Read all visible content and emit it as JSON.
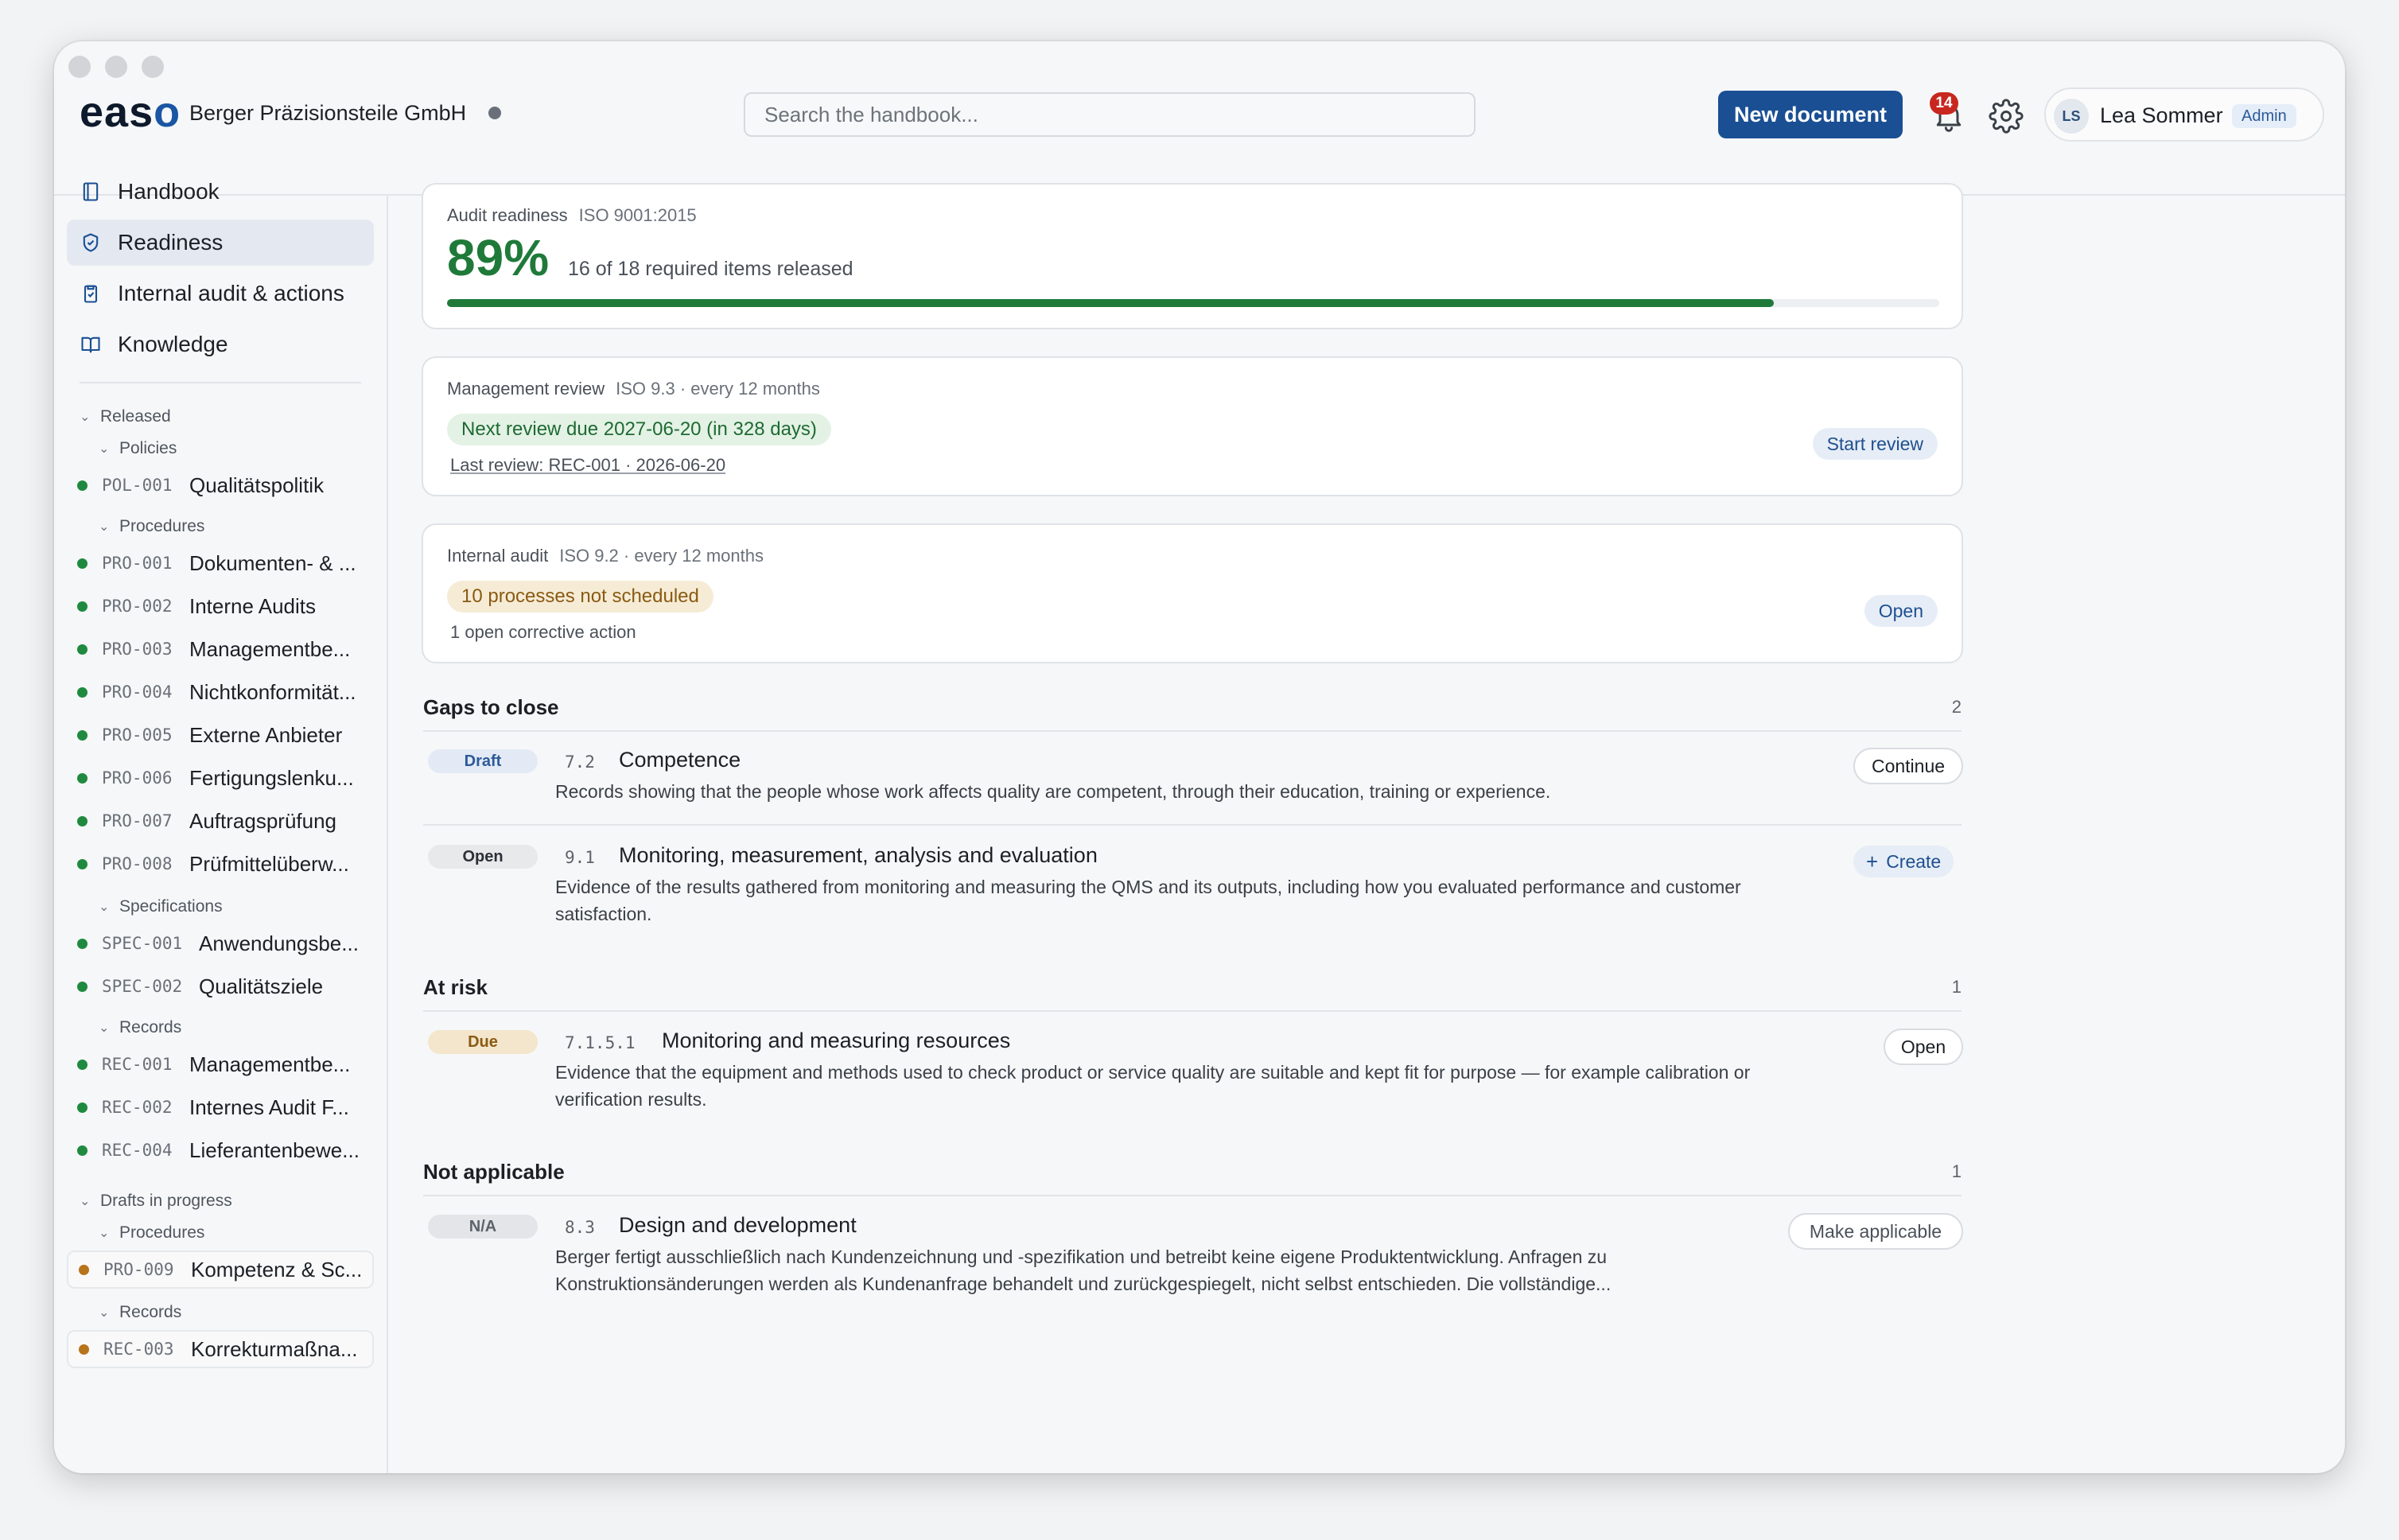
{
  "app": {
    "logo": "easo",
    "org_name": "Berger Präzisionsteile GmbH",
    "search_placeholder": "Search the handbook...",
    "new_document_label": "New document",
    "notification_count": "14",
    "user": {
      "initials": "LS",
      "name": "Lea Sommer",
      "role": "Admin"
    }
  },
  "sidebar": {
    "nav": [
      {
        "label": "Handbook",
        "icon": "book-icon"
      },
      {
        "label": "Readiness",
        "icon": "shield-check-icon",
        "active": true
      },
      {
        "label": "Internal audit & actions",
        "icon": "clipboard-icon"
      },
      {
        "label": "Knowledge",
        "icon": "open-book-icon"
      }
    ],
    "released": {
      "label": "Released",
      "policies_label": "Policies",
      "policies": [
        {
          "code": "POL-001",
          "title": "Qualitätspolitik"
        }
      ],
      "procedures_label": "Procedures",
      "procedures": [
        {
          "code": "PRO-001",
          "title": "Dokumenten- & ..."
        },
        {
          "code": "PRO-002",
          "title": "Interne Audits"
        },
        {
          "code": "PRO-003",
          "title": "Managementbe..."
        },
        {
          "code": "PRO-004",
          "title": "Nichtkonformität..."
        },
        {
          "code": "PRO-005",
          "title": "Externe Anbieter"
        },
        {
          "code": "PRO-006",
          "title": "Fertigungslenku..."
        },
        {
          "code": "PRO-007",
          "title": "Auftragsprüfung"
        },
        {
          "code": "PRO-008",
          "title": "Prüfmittelüberw..."
        }
      ],
      "specifications_label": "Specifications",
      "specifications": [
        {
          "code": "SPEC-001",
          "title": "Anwendungsbe..."
        },
        {
          "code": "SPEC-002",
          "title": "Qualitätsziele"
        }
      ],
      "records_label": "Records",
      "records": [
        {
          "code": "REC-001",
          "title": "Managementbe..."
        },
        {
          "code": "REC-002",
          "title": "Internes Audit F..."
        },
        {
          "code": "REC-004",
          "title": "Lieferantenbewe..."
        }
      ]
    },
    "drafts": {
      "label": "Drafts in progress",
      "procedures_label": "Procedures",
      "procedures": [
        {
          "code": "PRO-009",
          "title": "Kompetenz & Sc..."
        }
      ],
      "records_label": "Records",
      "records": [
        {
          "code": "REC-003",
          "title": "Korrekturmaßna..."
        }
      ]
    },
    "colors": {
      "released_dot": "#1f8a3f",
      "draft_dot": "#b8741a"
    }
  },
  "readiness": {
    "label": "Audit readiness",
    "standard": "ISO 9001:2015",
    "percent_text": "89%",
    "summary": "16 of 18 required items released",
    "progress_fraction": 0.889
  },
  "management_review": {
    "label": "Management review",
    "meta": "ISO 9.3 · every 12 months",
    "status": "Next review due 2027-06-20 (in 328 days)",
    "last_review": "Last review: REC-001 · 2026-06-20",
    "action": "Start review"
  },
  "internal_audit": {
    "label": "Internal audit",
    "meta": "ISO 9.2 · every 12 months",
    "status": "10 processes not scheduled",
    "note": "1 open corrective action",
    "action": "Open"
  },
  "sections": {
    "gaps": {
      "title": "Gaps to close",
      "count": "2",
      "items": [
        {
          "status": "Draft",
          "clause": "7.2",
          "title": "Competence",
          "desc": "Records showing that the people whose work affects quality are competent, through their education, training or experience.",
          "action": "Continue"
        },
        {
          "status": "Open",
          "clause": "9.1",
          "title": "Monitoring, measurement, analysis and evaluation",
          "desc": "Evidence of the results gathered from monitoring and measuring the QMS and its outputs, including how you evaluated performance and customer satisfaction.",
          "action": "Create"
        }
      ]
    },
    "at_risk": {
      "title": "At risk",
      "count": "1",
      "items": [
        {
          "status": "Due",
          "clause": "7.1.5.1",
          "title": "Monitoring and measuring resources",
          "desc": "Evidence that the equipment and methods used to check product or service quality are suitable and kept fit for purpose — for example calibration or verification results.",
          "action": "Open"
        }
      ]
    },
    "not_applicable": {
      "title": "Not applicable",
      "count": "1",
      "items": [
        {
          "status": "N/A",
          "clause": "8.3",
          "title": "Design and development",
          "desc": "Berger fertigt ausschließlich nach Kundenzeichnung und -spezifikation und betreibt keine eigene Produktentwicklung. Anfragen zu Konstruktionsänderungen werden als Kundenanfrage behandelt und zurückgespiegelt, nicht selbst entschieden. Die vollständige...",
          "action": "Make applicable"
        }
      ]
    }
  }
}
